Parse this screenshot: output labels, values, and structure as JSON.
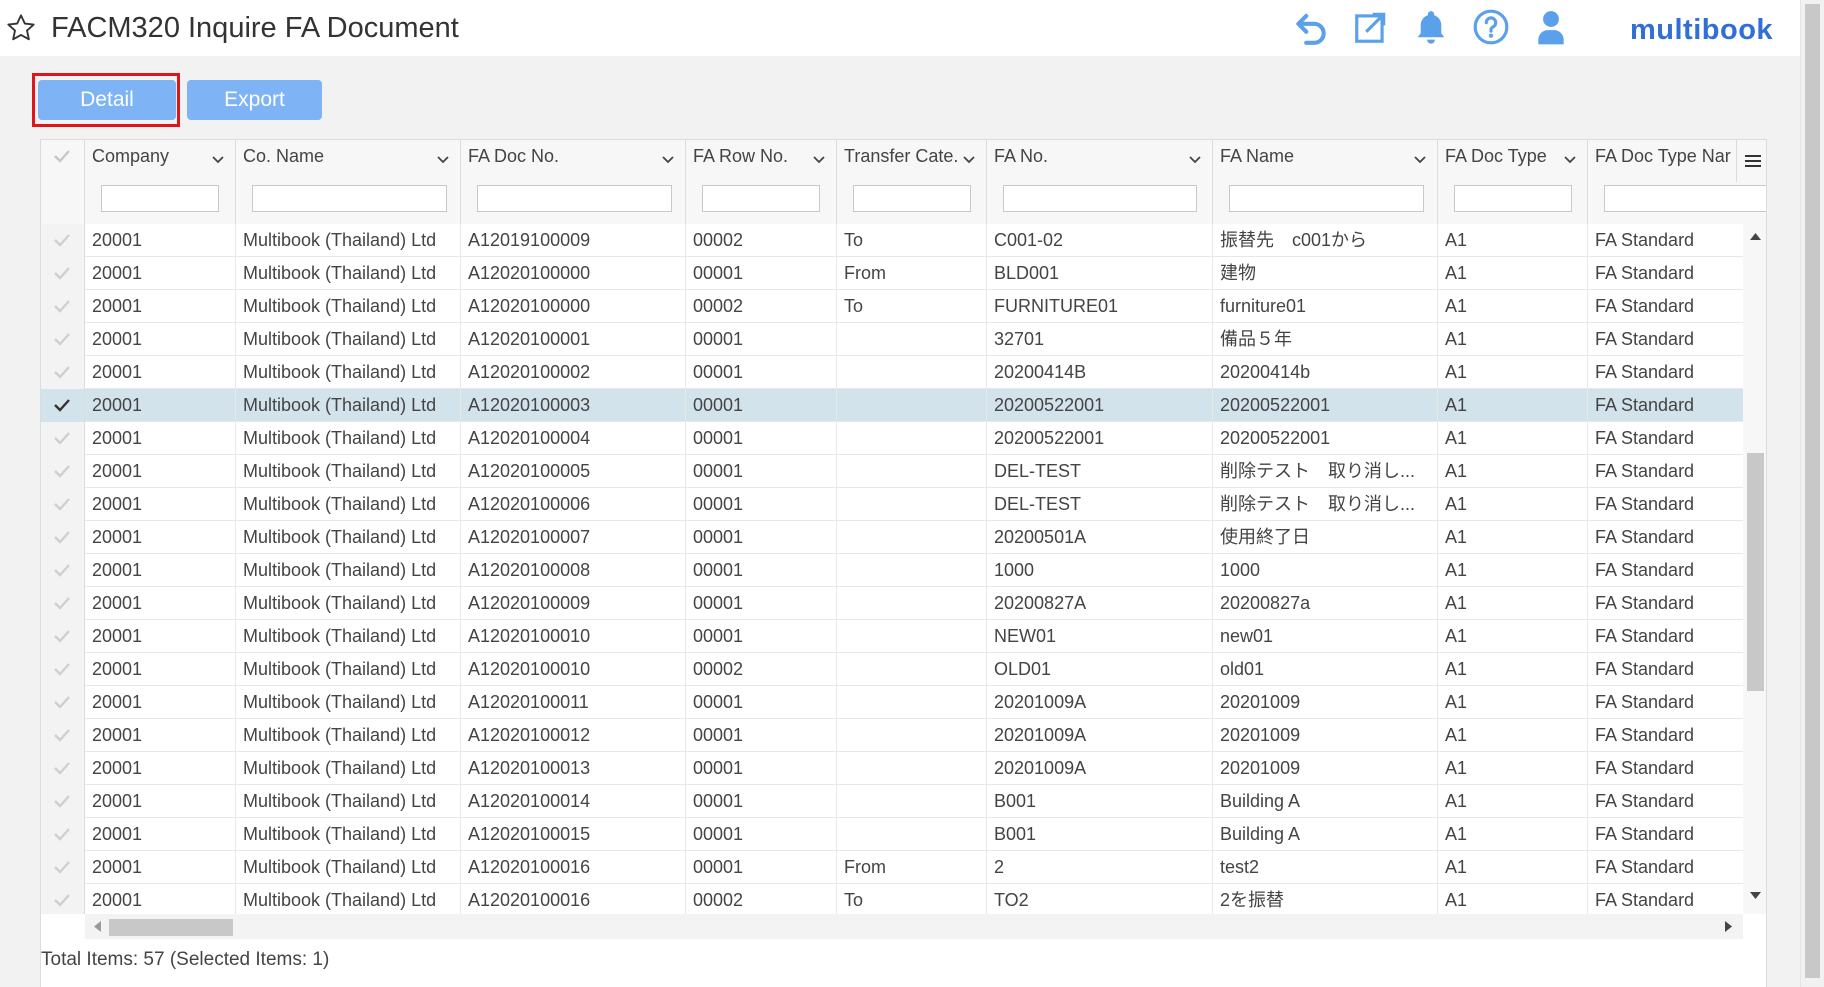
{
  "header": {
    "title": "FACM320 Inquire FA Document",
    "logo": "multibook",
    "icons": [
      "star-icon",
      "undo-icon",
      "open-external-icon",
      "bell-icon",
      "help-icon",
      "user-icon"
    ],
    "icon_color": "#5aa0ea"
  },
  "toolbar": {
    "detail_label": "Detail",
    "export_label": "Export"
  },
  "grid": {
    "columns": [
      "Company",
      "Co. Name",
      "FA Doc No.",
      "FA Row No.",
      "Transfer Cate...",
      "FA No.",
      "FA Name",
      "FA Doc Type",
      "FA Doc Type Nar"
    ],
    "rows": [
      {
        "company": "20001",
        "co_name": "Multibook (Thailand) Ltd",
        "doc_no": "A12019100009",
        "row_no": "00002",
        "transfer": "To",
        "fa_no": "C001-02",
        "fa_name": "振替先　c001から",
        "doc_type": "A1",
        "doc_type_name": "FA Standard",
        "selected": false
      },
      {
        "company": "20001",
        "co_name": "Multibook (Thailand) Ltd",
        "doc_no": "A12020100000",
        "row_no": "00001",
        "transfer": "From",
        "fa_no": "BLD001",
        "fa_name": "建物",
        "doc_type": "A1",
        "doc_type_name": "FA Standard",
        "selected": false
      },
      {
        "company": "20001",
        "co_name": "Multibook (Thailand) Ltd",
        "doc_no": "A12020100000",
        "row_no": "00002",
        "transfer": "To",
        "fa_no": "FURNITURE01",
        "fa_name": "furniture01",
        "doc_type": "A1",
        "doc_type_name": "FA Standard",
        "selected": false
      },
      {
        "company": "20001",
        "co_name": "Multibook (Thailand) Ltd",
        "doc_no": "A12020100001",
        "row_no": "00001",
        "transfer": "",
        "fa_no": "32701",
        "fa_name": "備品５年",
        "doc_type": "A1",
        "doc_type_name": "FA Standard",
        "selected": false
      },
      {
        "company": "20001",
        "co_name": "Multibook (Thailand) Ltd",
        "doc_no": "A12020100002",
        "row_no": "00001",
        "transfer": "",
        "fa_no": "20200414B",
        "fa_name": "20200414b",
        "doc_type": "A1",
        "doc_type_name": "FA Standard",
        "selected": false
      },
      {
        "company": "20001",
        "co_name": "Multibook (Thailand) Ltd",
        "doc_no": "A12020100003",
        "row_no": "00001",
        "transfer": "",
        "fa_no": "20200522001",
        "fa_name": "20200522001",
        "doc_type": "A1",
        "doc_type_name": "FA Standard",
        "selected": true
      },
      {
        "company": "20001",
        "co_name": "Multibook (Thailand) Ltd",
        "doc_no": "A12020100004",
        "row_no": "00001",
        "transfer": "",
        "fa_no": "20200522001",
        "fa_name": "20200522001",
        "doc_type": "A1",
        "doc_type_name": "FA Standard",
        "selected": false
      },
      {
        "company": "20001",
        "co_name": "Multibook (Thailand) Ltd",
        "doc_no": "A12020100005",
        "row_no": "00001",
        "transfer": "",
        "fa_no": "DEL-TEST",
        "fa_name": "削除テスト　取り消し...",
        "doc_type": "A1",
        "doc_type_name": "FA Standard",
        "selected": false
      },
      {
        "company": "20001",
        "co_name": "Multibook (Thailand) Ltd",
        "doc_no": "A12020100006",
        "row_no": "00001",
        "transfer": "",
        "fa_no": "DEL-TEST",
        "fa_name": "削除テスト　取り消し...",
        "doc_type": "A1",
        "doc_type_name": "FA Standard",
        "selected": false
      },
      {
        "company": "20001",
        "co_name": "Multibook (Thailand) Ltd",
        "doc_no": "A12020100007",
        "row_no": "00001",
        "transfer": "",
        "fa_no": "20200501A",
        "fa_name": "使用終了日",
        "doc_type": "A1",
        "doc_type_name": "FA Standard",
        "selected": false
      },
      {
        "company": "20001",
        "co_name": "Multibook (Thailand) Ltd",
        "doc_no": "A12020100008",
        "row_no": "00001",
        "transfer": "",
        "fa_no": "1000",
        "fa_name": "1000",
        "doc_type": "A1",
        "doc_type_name": "FA Standard",
        "selected": false
      },
      {
        "company": "20001",
        "co_name": "Multibook (Thailand) Ltd",
        "doc_no": "A12020100009",
        "row_no": "00001",
        "transfer": "",
        "fa_no": "20200827A",
        "fa_name": "20200827a",
        "doc_type": "A1",
        "doc_type_name": "FA Standard",
        "selected": false
      },
      {
        "company": "20001",
        "co_name": "Multibook (Thailand) Ltd",
        "doc_no": "A12020100010",
        "row_no": "00001",
        "transfer": "",
        "fa_no": "NEW01",
        "fa_name": "new01",
        "doc_type": "A1",
        "doc_type_name": "FA Standard",
        "selected": false
      },
      {
        "company": "20001",
        "co_name": "Multibook (Thailand) Ltd",
        "doc_no": "A12020100010",
        "row_no": "00002",
        "transfer": "",
        "fa_no": "OLD01",
        "fa_name": "old01",
        "doc_type": "A1",
        "doc_type_name": "FA Standard",
        "selected": false
      },
      {
        "company": "20001",
        "co_name": "Multibook (Thailand) Ltd",
        "doc_no": "A12020100011",
        "row_no": "00001",
        "transfer": "",
        "fa_no": "20201009A",
        "fa_name": "20201009",
        "doc_type": "A1",
        "doc_type_name": "FA Standard",
        "selected": false
      },
      {
        "company": "20001",
        "co_name": "Multibook (Thailand) Ltd",
        "doc_no": "A12020100012",
        "row_no": "00001",
        "transfer": "",
        "fa_no": "20201009A",
        "fa_name": "20201009",
        "doc_type": "A1",
        "doc_type_name": "FA Standard",
        "selected": false
      },
      {
        "company": "20001",
        "co_name": "Multibook (Thailand) Ltd",
        "doc_no": "A12020100013",
        "row_no": "00001",
        "transfer": "",
        "fa_no": "20201009A",
        "fa_name": "20201009",
        "doc_type": "A1",
        "doc_type_name": "FA Standard",
        "selected": false
      },
      {
        "company": "20001",
        "co_name": "Multibook (Thailand) Ltd",
        "doc_no": "A12020100014",
        "row_no": "00001",
        "transfer": "",
        "fa_no": "B001",
        "fa_name": "Building A",
        "doc_type": "A1",
        "doc_type_name": "FA Standard",
        "selected": false
      },
      {
        "company": "20001",
        "co_name": "Multibook (Thailand) Ltd",
        "doc_no": "A12020100015",
        "row_no": "00001",
        "transfer": "",
        "fa_no": "B001",
        "fa_name": "Building A",
        "doc_type": "A1",
        "doc_type_name": "FA Standard",
        "selected": false
      },
      {
        "company": "20001",
        "co_name": "Multibook (Thailand) Ltd",
        "doc_no": "A12020100016",
        "row_no": "00001",
        "transfer": "From",
        "fa_no": "2",
        "fa_name": "test2",
        "doc_type": "A1",
        "doc_type_name": "FA Standard",
        "selected": false
      },
      {
        "company": "20001",
        "co_name": "Multibook (Thailand) Ltd",
        "doc_no": "A12020100016",
        "row_no": "00002",
        "transfer": "To",
        "fa_no": "TO2",
        "fa_name": "2を振替",
        "doc_type": "A1",
        "doc_type_name": "FA Standard",
        "selected": false
      }
    ]
  },
  "footer": {
    "summary": "Total Items: 57 (Selected Items: 1)"
  }
}
